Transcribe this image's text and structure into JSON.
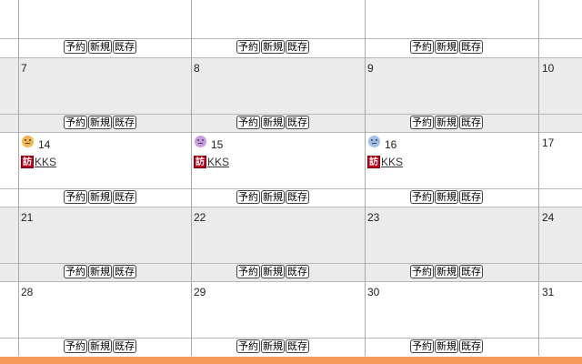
{
  "buttons": {
    "reserve": "予約",
    "new": "新規",
    "existing": "既存"
  },
  "weeks": [
    {
      "days": [
        "",
        "",
        "",
        ""
      ]
    },
    {
      "days": [
        "7",
        "8",
        "9",
        "10"
      ]
    },
    {
      "days": [
        "14",
        "15",
        "16",
        "17"
      ]
    },
    {
      "days": [
        "21",
        "22",
        "23",
        "24"
      ]
    },
    {
      "days": [
        "28",
        "29",
        "30",
        "31"
      ]
    }
  ],
  "events": {
    "d14": {
      "badge": "訪",
      "label": "KKS",
      "mood_color": "#f3b54a"
    },
    "d15": {
      "badge": "訪",
      "label": "KKS",
      "mood_color": "#c89be0"
    },
    "d16": {
      "badge": "訪",
      "label": "KKS",
      "mood_color": "#9cc0e8"
    }
  },
  "colors": {
    "weekday_bg": "#ebebeb",
    "grid": "#a9a9a9",
    "footer_bar": "#f39a5a"
  }
}
